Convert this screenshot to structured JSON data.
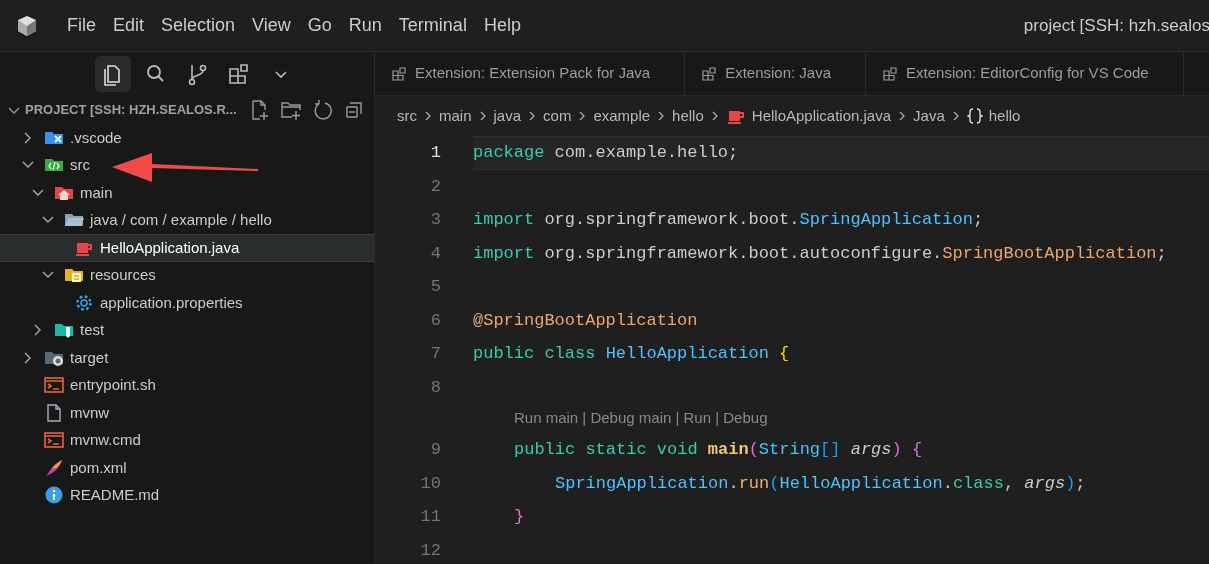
{
  "menu": [
    "File",
    "Edit",
    "Selection",
    "View",
    "Go",
    "Run",
    "Terminal",
    "Help"
  ],
  "window": {
    "title": "project [SSH: hzh.sealos"
  },
  "view_icons": [
    {
      "kind": "explorer",
      "selected": true
    },
    {
      "kind": "search",
      "selected": false
    },
    {
      "kind": "source-control",
      "selected": false
    },
    {
      "kind": "extensions",
      "selected": false
    },
    {
      "kind": "more",
      "selected": false
    }
  ],
  "explorer": {
    "header": "PROJECT [SSH: HZH.SEALOS.R...",
    "expanded": true,
    "tree": [
      {
        "label": ".vscode",
        "kind": "folder-vscode",
        "expanded": false,
        "selected": false
      },
      {
        "label": "src",
        "kind": "folder-src",
        "expanded": true,
        "selected": false,
        "children": [
          {
            "label": "main",
            "kind": "folder-home",
            "expanded": true,
            "selected": false,
            "children": [
              {
                "label": "java / com / example / hello",
                "kind": "folder",
                "expanded": true,
                "selected": false,
                "children": [
                  {
                    "label": "HelloApplication.java",
                    "kind": "java",
                    "selected": true
                  }
                ]
              },
              {
                "label": "resources",
                "kind": "folder-resources",
                "expanded": true,
                "selected": false,
                "children": [
                  {
                    "label": "application.properties",
                    "kind": "gear",
                    "selected": false
                  }
                ]
              }
            ]
          },
          {
            "label": "test",
            "kind": "folder-test",
            "expanded": false,
            "selected": false
          }
        ]
      },
      {
        "label": "target",
        "kind": "folder-target",
        "expanded": false,
        "selected": false
      },
      {
        "label": "entrypoint.sh",
        "kind": "terminal",
        "selected": false
      },
      {
        "label": "mvnw",
        "kind": "file",
        "selected": false
      },
      {
        "label": "mvnw.cmd",
        "kind": "terminal",
        "selected": false
      },
      {
        "label": "pom.xml",
        "kind": "feather",
        "selected": false
      },
      {
        "label": "README.md",
        "kind": "info",
        "selected": false
      }
    ]
  },
  "tabs": [
    {
      "label": "Extension: Extension Pack for Java",
      "selected": false
    },
    {
      "label": "Extension: Java",
      "selected": false
    },
    {
      "label": "Extension: EditorConfig for VS Code",
      "selected": false
    }
  ],
  "breadcrumbs": [
    {
      "label": "src"
    },
    {
      "label": "main"
    },
    {
      "label": "java"
    },
    {
      "label": "com"
    },
    {
      "label": "example"
    },
    {
      "label": "hello"
    },
    {
      "label": "HelloApplication.java",
      "kind": "java"
    },
    {
      "label": "Java"
    },
    {
      "label": "hello",
      "kind": "braces"
    }
  ],
  "code": [
    {
      "kind": "line",
      "number": "1",
      "current": true,
      "tokens": [
        {
          "kind": "keyword",
          "s": "package"
        },
        {
          "kind": "plain",
          "s": " com.example.hello;"
        }
      ]
    },
    {
      "kind": "line",
      "number": "2",
      "current": false
    },
    {
      "kind": "line",
      "number": "3",
      "current": false,
      "tokens": [
        {
          "kind": "keyword",
          "s": "import"
        },
        {
          "kind": "plain",
          "s": " org.springframework.boot."
        },
        {
          "kind": "type",
          "s": "SpringApplication"
        },
        {
          "kind": "plain",
          "s": ";"
        }
      ]
    },
    {
      "kind": "line",
      "number": "4",
      "current": false,
      "tokens": [
        {
          "kind": "keyword",
          "s": "import"
        },
        {
          "kind": "plain",
          "s": " org.springframework.boot.autoconfigure."
        },
        {
          "kind": "annotation",
          "s": "SpringBootApplication"
        },
        {
          "kind": "plain",
          "s": ";"
        }
      ]
    },
    {
      "kind": "line",
      "number": "5",
      "current": false
    },
    {
      "kind": "line",
      "number": "6",
      "current": false,
      "tokens": [
        {
          "kind": "annotation",
          "s": "@SpringBootApplication"
        }
      ]
    },
    {
      "kind": "line",
      "number": "7",
      "current": false,
      "tokens": [
        {
          "kind": "keyword",
          "s": "public class "
        },
        {
          "kind": "type",
          "s": "HelloApplication"
        },
        {
          "kind": "bracket1",
          "s": " {"
        }
      ],
      "children": [
        {
          "kind": "line",
          "number": "8",
          "current": false
        },
        {
          "kind": "codelens",
          "text": "Run main | Debug main | Run | Debug"
        },
        {
          "kind": "line",
          "number": "9",
          "current": false,
          "tokens": [
            {
              "kind": "keyword",
              "s": "public static void "
            },
            {
              "kind": "function",
              "s": "main"
            },
            {
              "kind": "bracket2",
              "s": "("
            },
            {
              "kind": "type",
              "s": "String"
            },
            {
              "kind": "bracket3",
              "s": "[]"
            },
            {
              "kind": "param",
              "s": " args"
            },
            {
              "kind": "bracket2",
              "s": ")"
            },
            {
              "kind": "bracket2",
              "s": " {"
            }
          ],
          "children": [
            {
              "kind": "line",
              "number": "10",
              "current": false,
              "tokens": [
                {
                  "kind": "type",
                  "s": "SpringApplication"
                },
                {
                  "kind": "plain",
                  "s": "."
                },
                {
                  "kind": "method",
                  "s": "run"
                },
                {
                  "kind": "bracket3",
                  "s": "("
                },
                {
                  "kind": "type",
                  "s": "HelloApplication"
                },
                {
                  "kind": "plain",
                  "s": "."
                },
                {
                  "kind": "keyword",
                  "s": "class"
                },
                {
                  "kind": "plain",
                  "s": ", "
                },
                {
                  "kind": "param",
                  "s": "args"
                },
                {
                  "kind": "bracket3",
                  "s": ")"
                },
                {
                  "kind": "plain",
                  "s": ";"
                }
              ]
            }
          ]
        },
        {
          "kind": "line",
          "number": "11",
          "current": false,
          "tokens": [
            {
              "kind": "bracket2",
              "s": "}"
            }
          ]
        },
        {
          "kind": "line",
          "number": "12",
          "current": false
        }
      ]
    }
  ]
}
